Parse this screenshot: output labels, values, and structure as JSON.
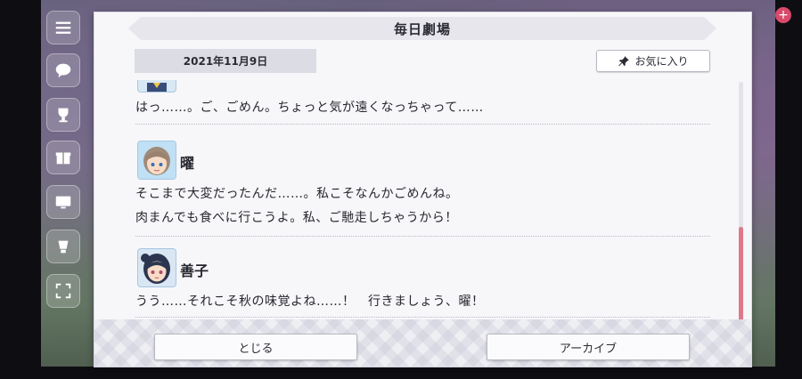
{
  "dialog": {
    "title": "毎日劇場",
    "date": "2021年11月9日",
    "favorite_label": "お気に入り",
    "close_label": "とじる",
    "archive_label": "アーカイブ"
  },
  "entries": [
    {
      "speaker": "",
      "lines": [
        "はっ……。ご、ごめん。ちょっと気が遠くなっちゃって……"
      ]
    },
    {
      "speaker": "曜",
      "lines": [
        "そこまで大変だったんだ……。私こそなんかごめんね。",
        "肉まんでも食べに行こうよ。私、ご馳走しちゃうから！"
      ]
    },
    {
      "speaker": "善子",
      "lines": [
        "うう……それこそ秋の味覚よね……！　行きましょう、曜！"
      ]
    }
  ],
  "icons": {
    "favorite": "pin-icon",
    "menu": "menu-icon",
    "chat": "chat-icon",
    "trophy": "trophy-icon",
    "gift": "gift-icon",
    "screen": "screen-icon",
    "cup": "cup-icon",
    "expand": "expand-icon"
  },
  "colors": {
    "scroll_thumb": "#e07889",
    "accent_plus": "#d94a6a"
  }
}
